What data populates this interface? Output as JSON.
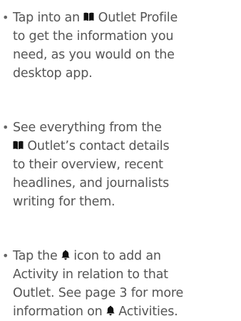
{
  "bullets": [
    {
      "lines": [
        {
          "parts": [
            {
              "t": "Tap into an "
            },
            {
              "icon": "book-icon"
            },
            {
              "t": " Outlet Profile"
            }
          ]
        },
        {
          "parts": [
            {
              "t": "to get the information you"
            }
          ]
        },
        {
          "parts": [
            {
              "t": "need, as you would on the"
            }
          ]
        },
        {
          "parts": [
            {
              "t": "desktop app."
            }
          ]
        }
      ]
    },
    {
      "lines": [
        {
          "parts": [
            {
              "t": "See everything from the"
            }
          ]
        },
        {
          "parts": [
            {
              "icon": "book-icon"
            },
            {
              "t": " Outlet’s contact details"
            }
          ]
        },
        {
          "parts": [
            {
              "t": "to their overview, recent"
            }
          ]
        },
        {
          "parts": [
            {
              "t": "headlines, and journalists"
            }
          ]
        },
        {
          "parts": [
            {
              "t": "writing for them."
            }
          ]
        }
      ]
    },
    {
      "lines": [
        {
          "parts": [
            {
              "t": "Tap the "
            },
            {
              "icon": "bell-icon"
            },
            {
              "t": " icon to add an"
            }
          ]
        },
        {
          "parts": [
            {
              "t": "Activity in relation to that"
            }
          ]
        },
        {
          "parts": [
            {
              "t": "Outlet. See page 3 for more"
            }
          ]
        },
        {
          "parts": [
            {
              "t": "information on "
            },
            {
              "icon": "bell-icon"
            },
            {
              "t": " Activities."
            }
          ]
        }
      ]
    }
  ],
  "bullet_glyph": "•",
  "colors": {
    "text": "#555555",
    "icon": "#111111"
  }
}
